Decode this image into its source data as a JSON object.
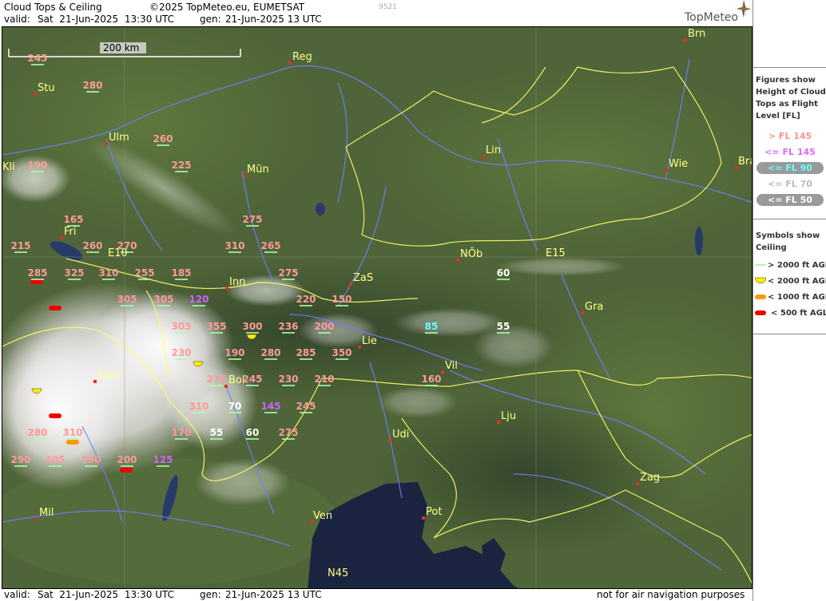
{
  "header": {
    "title": "Cloud Tops & Ceiling",
    "copyright": "©2025 TopMeteo.eu, EUMETSAT",
    "valid_label": "valid:",
    "valid_time": "Sat  21-Jun-2025  13:30 UTC",
    "gen_label": "gen:",
    "gen_time": "21-Jun-2025 13 UTC",
    "frame_id": "9521",
    "logo": "TopMeteo"
  },
  "footer": {
    "valid_label": "valid:",
    "valid_time": "Sat  21-Jun-2025  13:30 UTC",
    "gen_label": "gen:",
    "gen_time": "21-Jun-2025 13 UTC",
    "disclaimer": "not for air navigation purposes"
  },
  "map": {
    "scale_bar": "200 km",
    "grid_labels": [
      "E15",
      "E10",
      "N45"
    ],
    "cities": [
      "Brn",
      "Reg",
      "Stu",
      "Ulm",
      "Kli",
      "Mün",
      "Lin",
      "Wie",
      "Bra",
      "Fri",
      "NÖb",
      "Inn",
      "ZaS",
      "Gra",
      "Lie",
      "Vil",
      "Sam",
      "Bol",
      "Lju",
      "Udi",
      "Zag",
      "Mil",
      "Ven",
      "Pot"
    ],
    "cloud_tops": [
      {
        "v": "245",
        "c": "pink"
      },
      {
        "v": "280",
        "c": "pink"
      },
      {
        "v": "260",
        "c": "pink"
      },
      {
        "v": "225",
        "c": "pink"
      },
      {
        "v": "190",
        "c": "pink"
      },
      {
        "v": "275",
        "c": "pink"
      },
      {
        "v": "165",
        "c": "pink"
      },
      {
        "v": "215",
        "c": "pink"
      },
      {
        "v": "260",
        "c": "pink"
      },
      {
        "v": "270",
        "c": "pink"
      },
      {
        "v": "310",
        "c": "pink"
      },
      {
        "v": "265",
        "c": "pink"
      },
      {
        "v": "285",
        "c": "pink"
      },
      {
        "v": "325",
        "c": "pink"
      },
      {
        "v": "310",
        "c": "pink"
      },
      {
        "v": "255",
        "c": "pink"
      },
      {
        "v": "185",
        "c": "pink"
      },
      {
        "v": "275",
        "c": "pink"
      },
      {
        "v": "60",
        "c": "white"
      },
      {
        "v": "305",
        "c": "pink"
      },
      {
        "v": "305",
        "c": "pink"
      },
      {
        "v": "120",
        "c": "violet"
      },
      {
        "v": "220",
        "c": "pink"
      },
      {
        "v": "150",
        "c": "pink"
      },
      {
        "v": "305",
        "c": "pink"
      },
      {
        "v": "355",
        "c": "pink"
      },
      {
        "v": "300",
        "c": "pink"
      },
      {
        "v": "236",
        "c": "pink"
      },
      {
        "v": "200",
        "c": "pink"
      },
      {
        "v": "85",
        "c": "cyan"
      },
      {
        "v": "55",
        "c": "white"
      },
      {
        "v": "230",
        "c": "pink"
      },
      {
        "v": "190",
        "c": "pink"
      },
      {
        "v": "280",
        "c": "pink"
      },
      {
        "v": "285",
        "c": "pink"
      },
      {
        "v": "350",
        "c": "pink"
      },
      {
        "v": "275",
        "c": "pink"
      },
      {
        "v": "245",
        "c": "pink"
      },
      {
        "v": "230",
        "c": "pink"
      },
      {
        "v": "210",
        "c": "pink"
      },
      {
        "v": "160",
        "c": "pink"
      },
      {
        "v": "310",
        "c": "pink"
      },
      {
        "v": "70",
        "c": "white"
      },
      {
        "v": "145",
        "c": "violet"
      },
      {
        "v": "245",
        "c": "pink"
      },
      {
        "v": "170",
        "c": "pink"
      },
      {
        "v": "55",
        "c": "white"
      },
      {
        "v": "60",
        "c": "white"
      },
      {
        "v": "275",
        "c": "pink"
      },
      {
        "v": "280",
        "c": "pink"
      },
      {
        "v": "310",
        "c": "pink"
      },
      {
        "v": "290",
        "c": "pink"
      },
      {
        "v": "305",
        "c": "pink"
      },
      {
        "v": "150",
        "c": "pink"
      },
      {
        "v": "200",
        "c": "pink"
      },
      {
        "v": "125",
        "c": "violet"
      }
    ]
  },
  "legend": {
    "fl_title": "Figures show Height of Cloud Tops as Flight Level  [FL]",
    "fl_title_lines": [
      "Figures show",
      "Height of Cloud",
      "Tops as Flight",
      "Level  [FL]"
    ],
    "fl_items": [
      {
        "label": "> FL 145",
        "color": "#ff9090"
      },
      {
        "label": "<= FL 145",
        "color": "#dd66ff"
      },
      {
        "label": "<= FL 90",
        "color": "#66ffff"
      },
      {
        "label": "<= FL 70",
        "color": "#dddddd"
      },
      {
        "label": "<= FL 50",
        "color": "#ffffff"
      }
    ],
    "ceiling_title_lines": [
      "Symbols show",
      "Ceiling"
    ],
    "ceiling_items": [
      {
        "label": "> 2000 ft AGL",
        "color": "#aaffaa"
      },
      {
        "label": "< 2000 ft AGL",
        "color": "#ffee00"
      },
      {
        "label": "< 1000 ft AGL",
        "color": "#ff9900"
      },
      {
        "label": "< 500 ft AGL",
        "color": "#ee0000"
      }
    ]
  },
  "colors": {
    "pink": "#ff9a9a",
    "violet": "#cc66ff",
    "cyan": "#66ffff",
    "white": "#ffffff",
    "city": "#ffff88",
    "border": "#ffff66",
    "river": "#6f7fff",
    "sea": "#1a2440"
  }
}
